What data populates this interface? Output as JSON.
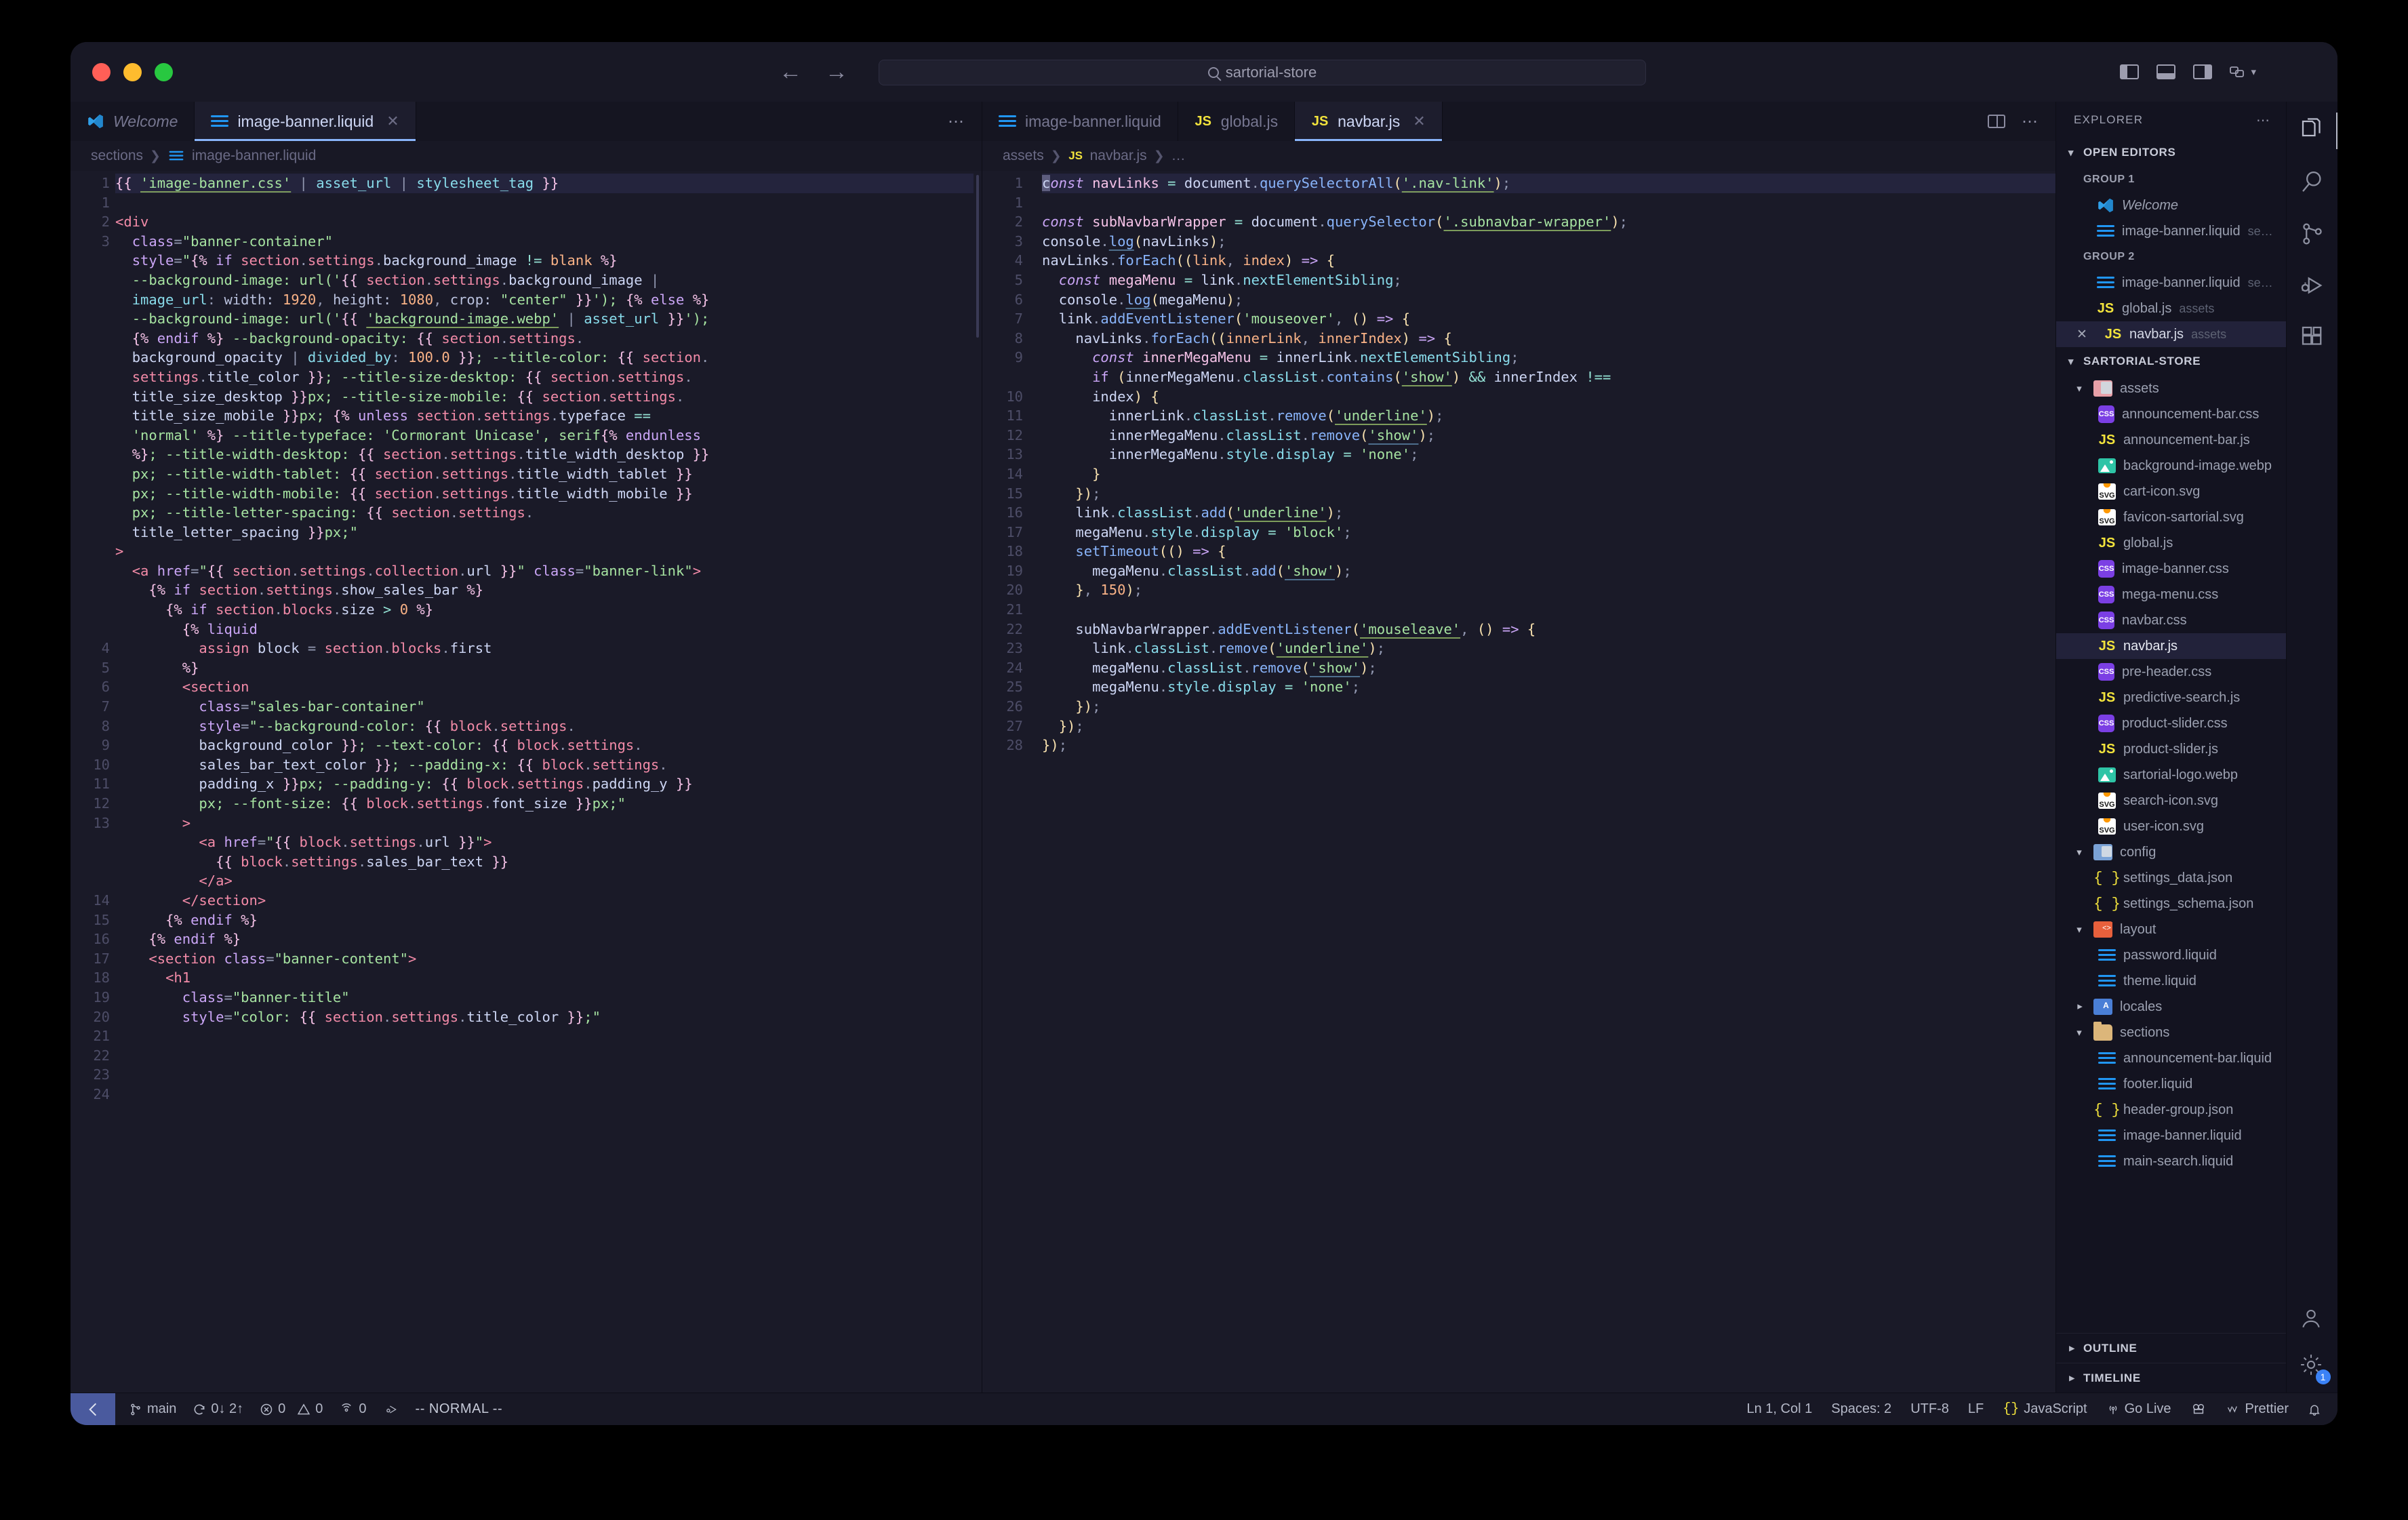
{
  "window": {
    "traffic_lights": [
      "close",
      "minimize",
      "maximize"
    ],
    "command_center_text": "sartorial-store"
  },
  "editor_groups": [
    {
      "name": "group-1",
      "tabs": [
        {
          "label": "Welcome",
          "icon": "vscode-icon",
          "active": false,
          "italic": true,
          "closable": false
        },
        {
          "label": "image-banner.liquid",
          "icon": "liquid-icon",
          "active": true,
          "italic": false,
          "closable": true
        }
      ],
      "breadcrumbs": [
        "sections",
        "image-banner.liquid"
      ],
      "file": "image-banner.liquid"
    },
    {
      "name": "group-2",
      "tabs": [
        {
          "label": "image-banner.liquid",
          "icon": "liquid-icon",
          "active": false,
          "italic": false,
          "closable": false
        },
        {
          "label": "global.js",
          "icon": "js-icon",
          "active": false,
          "italic": false,
          "closable": false
        },
        {
          "label": "navbar.js",
          "icon": "js-icon",
          "active": true,
          "italic": false,
          "closable": true
        }
      ],
      "breadcrumbs": [
        "assets",
        "navbar.js",
        "…"
      ],
      "file": "navbar.js"
    }
  ],
  "left_code": {
    "line_numbers": [
      "1",
      "1",
      "2",
      "3",
      "",
      "",
      "",
      "",
      "",
      "",
      "",
      "",
      "",
      "",
      "",
      "",
      "",
      "4",
      "5",
      "6",
      "7",
      "8",
      "9",
      "10",
      "11",
      "12",
      "13",
      "",
      "",
      "",
      "14",
      "15",
      "16",
      "17",
      "18",
      "19",
      "20",
      "21",
      "22",
      "23",
      "24"
    ],
    "lines": [
      "{{ 'image-banner.css' | asset_url | stylesheet_tag }}",
      "<div",
      "  class=\"banner-container\"",
      "  style=\"{% if section.settings.background_image != blank %}",
      "  --background-image: url('{{ section.settings.background_image |",
      "  image_url: width: 1920, height: 1080, crop: \"center\" }}'); {% else %}",
      "  --background-image: url('{{ 'background-image.webp' | asset_url }}');",
      "  {% endif %} --background-opacity: {{ section.settings.",
      "  background_opacity | divided_by: 100.0 }}; --title-color: {{ section.",
      "  settings.title_color }}; --title-size-desktop: {{ section.settings.",
      "  title_size_desktop }}px; --title-size-mobile: {{ section.settings.",
      "  title_size_mobile }}px; {% unless section.settings.typeface ==",
      "  'normal' %} --title-typeface: 'Cormorant Unicase', serif{% endunless",
      "  %}; --title-width-desktop: {{ section.settings.title_width_desktop }}",
      "  px; --title-width-tablet: {{ section.settings.title_width_tablet }}",
      "  px; --title-width-mobile: {{ section.settings.title_width_mobile }}",
      "  px; --title-letter-spacing: {{ section.settings.",
      "  title_letter_spacing }}px;\"",
      ">",
      "  <a href=\"{{ section.settings.collection.url }}\" class=\"banner-link\">",
      "    {% if section.settings.show_sales_bar %}",
      "      {% if section.blocks.size > 0 %}",
      "        {% liquid",
      "          assign block = section.blocks.first",
      "        %}",
      "        <section",
      "          class=\"sales-bar-container\"",
      "          style=\"--background-color: {{ block.settings.",
      "          background_color }}; --text-color: {{ block.settings.",
      "          sales_bar_text_color }}; --padding-x: {{ block.settings.",
      "          padding_x }}px; --padding-y: {{ block.settings.padding_y }}",
      "          px; --font-size: {{ block.settings.font_size }}px;\"",
      "        >",
      "          <a href=\"{{ block.settings.url }}\">",
      "            {{ block.settings.sales_bar_text }}",
      "          </a>",
      "        </section>",
      "      {% endif %}",
      "    {% endif %}",
      "    <section class=\"banner-content\">",
      "      <h1",
      "        class=\"banner-title\"",
      "        style=\"color: {{ section.settings.title_color }};\""
    ]
  },
  "right_code": {
    "line_numbers": [
      "1",
      "1",
      "2",
      "3",
      "4",
      "5",
      "6",
      "7",
      "8",
      "9",
      "",
      "10",
      "11",
      "12",
      "13",
      "14",
      "15",
      "16",
      "17",
      "18",
      "19",
      "20",
      "21",
      "22",
      "23",
      "24",
      "25",
      "26",
      "27",
      "28"
    ],
    "lines": [
      "const navLinks = document.querySelectorAll('.nav-link');",
      "const subNavbarWrapper = document.querySelector('.subnavbar-wrapper');",
      "console.log(navLinks);",
      "navLinks.forEach((link, index) => {",
      "  const megaMenu = link.nextElementSibling;",
      "  console.log(megaMenu);",
      "  link.addEventListener('mouseover', () => {",
      "    navLinks.forEach((innerLink, innerIndex) => {",
      "      const innerMegaMenu = innerLink.nextElementSibling;",
      "      if (innerMegaMenu.classList.contains('show') && innerIndex !==",
      "      index) {",
      "        innerLink.classList.remove('underline');",
      "        innerMegaMenu.classList.remove('show');",
      "        innerMegaMenu.style.display = 'none';",
      "      }",
      "    });",
      "    link.classList.add('underline');",
      "    megaMenu.style.display = 'block';",
      "    setTimeout(() => {",
      "      megaMenu.classList.add('show');",
      "    }, 150);",
      "",
      "    subNavbarWrapper.addEventListener('mouseleave', () => {",
      "      link.classList.remove('underline');",
      "      megaMenu.classList.remove('show');",
      "      megaMenu.style.display = 'none';",
      "    });",
      "  });",
      "});",
      ""
    ]
  },
  "sidebar": {
    "title": "EXPLORER",
    "more_label": "…",
    "open_editors": {
      "label": "OPEN EDITORS",
      "groups": [
        {
          "label": "GROUP 1",
          "items": [
            {
              "name": "Welcome",
              "desc": "",
              "icon": "vscode-icon",
              "italic": true,
              "active": false,
              "close": false
            },
            {
              "name": "image-banner.liquid",
              "desc": "se…",
              "icon": "liquid-icon",
              "italic": false,
              "active": false,
              "close": false
            }
          ]
        },
        {
          "label": "GROUP 2",
          "items": [
            {
              "name": "image-banner.liquid",
              "desc": "se…",
              "icon": "liquid-icon",
              "italic": false,
              "active": false,
              "close": false
            },
            {
              "name": "global.js",
              "desc": "assets",
              "icon": "js-icon",
              "italic": false,
              "active": false,
              "close": false
            },
            {
              "name": "navbar.js",
              "desc": "assets",
              "icon": "js-icon",
              "italic": false,
              "active": true,
              "close": true
            }
          ]
        }
      ]
    },
    "project": {
      "label": "SARTORIAL-STORE",
      "tree": [
        {
          "depth": 1,
          "name": "assets",
          "type": "folder",
          "folder_kind": "assets",
          "expanded": true
        },
        {
          "depth": 2,
          "name": "announcement-bar.css",
          "type": "css"
        },
        {
          "depth": 2,
          "name": "announcement-bar.js",
          "type": "js"
        },
        {
          "depth": 2,
          "name": "background-image.webp",
          "type": "image"
        },
        {
          "depth": 2,
          "name": "cart-icon.svg",
          "type": "svg"
        },
        {
          "depth": 2,
          "name": "favicon-sartorial.svg",
          "type": "svg"
        },
        {
          "depth": 2,
          "name": "global.js",
          "type": "js"
        },
        {
          "depth": 2,
          "name": "image-banner.css",
          "type": "css"
        },
        {
          "depth": 2,
          "name": "mega-menu.css",
          "type": "css"
        },
        {
          "depth": 2,
          "name": "navbar.css",
          "type": "css"
        },
        {
          "depth": 2,
          "name": "navbar.js",
          "type": "js",
          "active": true
        },
        {
          "depth": 2,
          "name": "pre-header.css",
          "type": "css"
        },
        {
          "depth": 2,
          "name": "predictive-search.js",
          "type": "js"
        },
        {
          "depth": 2,
          "name": "product-slider.css",
          "type": "css"
        },
        {
          "depth": 2,
          "name": "product-slider.js",
          "type": "js"
        },
        {
          "depth": 2,
          "name": "sartorial-logo.webp",
          "type": "image"
        },
        {
          "depth": 2,
          "name": "search-icon.svg",
          "type": "svg"
        },
        {
          "depth": 2,
          "name": "user-icon.svg",
          "type": "svg"
        },
        {
          "depth": 1,
          "name": "config",
          "type": "folder",
          "folder_kind": "config",
          "expanded": true
        },
        {
          "depth": 2,
          "name": "settings_data.json",
          "type": "json"
        },
        {
          "depth": 2,
          "name": "settings_schema.json",
          "type": "json"
        },
        {
          "depth": 1,
          "name": "layout",
          "type": "folder",
          "folder_kind": "layout",
          "expanded": true
        },
        {
          "depth": 2,
          "name": "password.liquid",
          "type": "liquid"
        },
        {
          "depth": 2,
          "name": "theme.liquid",
          "type": "liquid"
        },
        {
          "depth": 1,
          "name": "locales",
          "type": "folder",
          "folder_kind": "locales",
          "expanded": false
        },
        {
          "depth": 1,
          "name": "sections",
          "type": "folder",
          "folder_kind": "generic",
          "expanded": true
        },
        {
          "depth": 2,
          "name": "announcement-bar.liquid",
          "type": "liquid"
        },
        {
          "depth": 2,
          "name": "footer.liquid",
          "type": "liquid"
        },
        {
          "depth": 2,
          "name": "header-group.json",
          "type": "json"
        },
        {
          "depth": 2,
          "name": "image-banner.liquid",
          "type": "liquid"
        },
        {
          "depth": 2,
          "name": "main-search.liquid",
          "type": "liquid"
        }
      ]
    },
    "outline_label": "OUTLINE",
    "timeline_label": "TIMELINE"
  },
  "activity_bar": {
    "items": [
      {
        "name": "explorer-icon",
        "active": true
      },
      {
        "name": "search-icon",
        "active": false
      },
      {
        "name": "source-control-icon",
        "active": false
      },
      {
        "name": "run-debug-icon",
        "active": false
      },
      {
        "name": "extensions-icon",
        "active": false
      }
    ],
    "bottom_items": [
      {
        "name": "accounts-icon",
        "badge": ""
      },
      {
        "name": "settings-gear-icon",
        "badge": "1"
      }
    ]
  },
  "status_bar": {
    "vim_badge": "vscode-remote-icon",
    "branch": "main",
    "sync": "0↓ 2↑",
    "errors": "0",
    "warnings": "0",
    "ports": "0",
    "mode": "-- NORMAL --",
    "cursor_position": "Ln 1, Col 1",
    "indentation": "Spaces: 2",
    "encoding": "UTF-8",
    "eol": "LF",
    "language": "JavaScript",
    "go_live": "Go Live",
    "formatter": "Prettier",
    "notifications": "bell-icon"
  }
}
